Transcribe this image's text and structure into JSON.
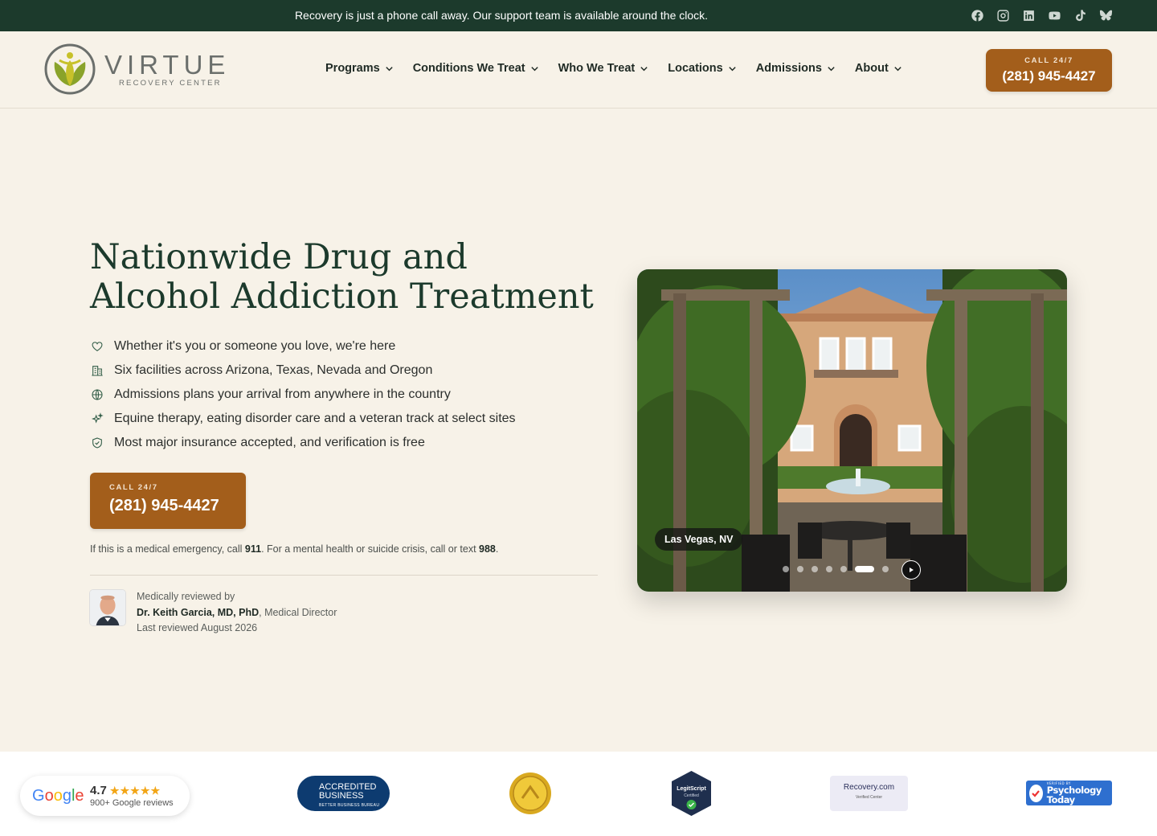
{
  "topbar": {
    "message": "Recovery is just a phone call away. Our support team is available around the clock.",
    "socials": [
      "facebook-icon",
      "instagram-icon",
      "linkedin-icon",
      "youtube-icon",
      "tiktok-icon",
      "bluesky-icon"
    ]
  },
  "header": {
    "logo_word": "VIRTUE",
    "logo_sub": "RECOVERY CENTER",
    "nav": [
      {
        "label": "Programs"
      },
      {
        "label": "Conditions We Treat"
      },
      {
        "label": "Who We Treat"
      },
      {
        "label": "Locations"
      },
      {
        "label": "Admissions"
      },
      {
        "label": "About"
      }
    ],
    "call_small": "CALL 24/7",
    "call_number": "(281) 945-4427"
  },
  "hero": {
    "title": "Nationwide Drug and Alcohol Addiction Treatment",
    "bullets": [
      {
        "icon": "heart-icon",
        "text": "Whether it's you or someone you love, we're here"
      },
      {
        "icon": "building-icon",
        "text": "Six facilities across Arizona, Texas, Nevada and Oregon"
      },
      {
        "icon": "globe-icon",
        "text": "Admissions plans your arrival from anywhere in the country"
      },
      {
        "icon": "sparkles-icon",
        "text": "Equine therapy, eating disorder care and a veteran track at select sites"
      },
      {
        "icon": "shield-check-icon",
        "text": "Most major insurance accepted, and verification is free"
      }
    ],
    "call_small": "CALL 24/7",
    "call_number": "(281) 945-4427",
    "emergency": {
      "pre": "If this is a medical emergency, call ",
      "n1": "911",
      "mid": ". For a mental health or suicide crisis, call or text ",
      "n2": "988",
      "post": "."
    },
    "reviewer": {
      "label": "Medically reviewed by",
      "name": "Dr. Keith Garcia, MD, PhD",
      "role": ", Medical Director",
      "date": "Last reviewed August 2026"
    }
  },
  "carousel": {
    "location": "Las Vegas, NV",
    "slide_count": 8,
    "active_index": 5
  },
  "badges": {
    "google_rating": "4.7",
    "google_stars": "★★★★★",
    "google_reviews": "900+ Google reviews",
    "google_word": "Google",
    "bbb_line1": "ACCREDITED",
    "bbb_line2": "BUSINESS",
    "bbb_mini": "BETTER BUSINESS BUREAU",
    "legit_text": "LegitScript",
    "legit_sub": "Certified",
    "recovery_text": "Recovery.com",
    "recovery_sub": "Verified Center",
    "pt_verified": "VERIFIED BY",
    "pt_text": "Psychology Today"
  }
}
